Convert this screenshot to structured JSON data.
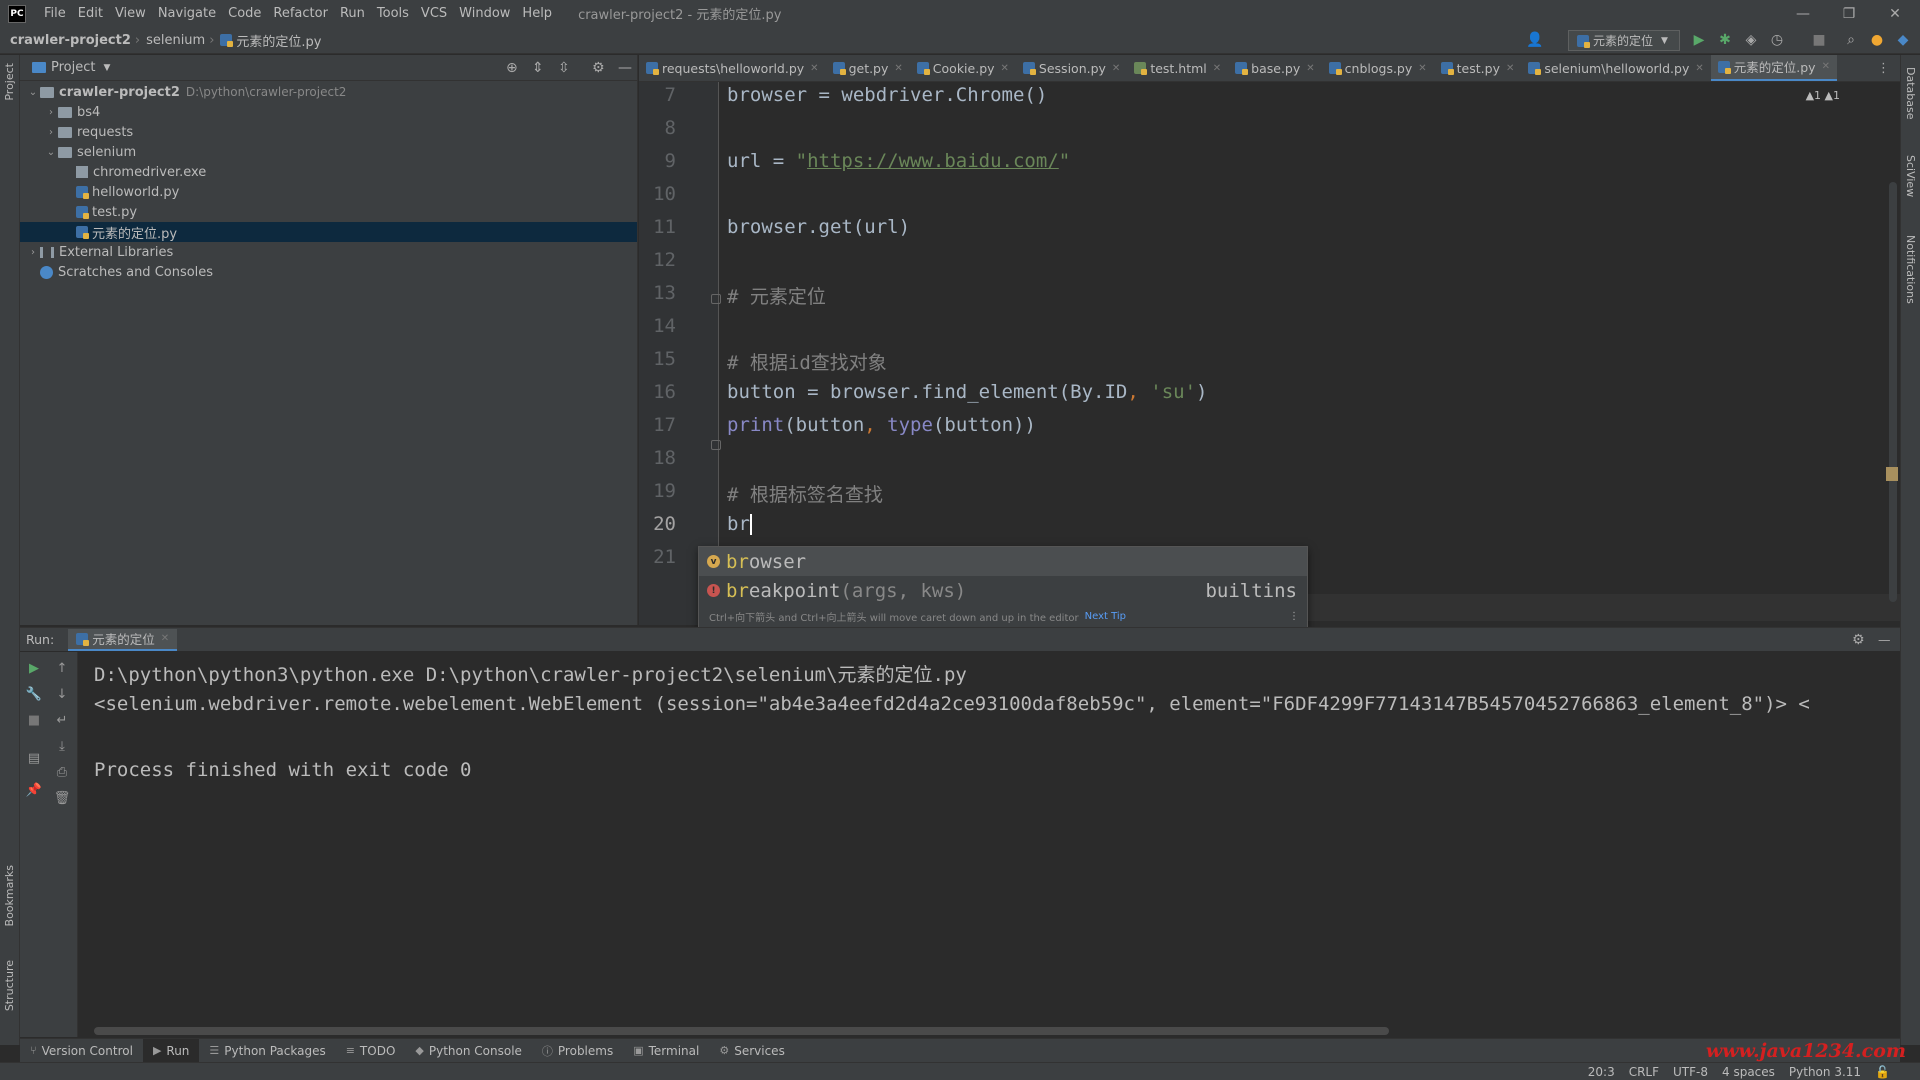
{
  "app": {
    "logo": "PC",
    "window_title": "crawler-project2 - 元素的定位.py"
  },
  "menu": [
    "File",
    "Edit",
    "View",
    "Navigate",
    "Code",
    "Refactor",
    "Run",
    "Tools",
    "VCS",
    "Window",
    "Help"
  ],
  "breadcrumb": {
    "project": "crawler-project2",
    "folder": "selenium",
    "file": "元素的定位.py"
  },
  "run_config": "元素的定位",
  "project_panel": {
    "title": "Project",
    "tree": [
      {
        "label": "crawler-project2",
        "path": "D:\\python\\crawler-project2",
        "depth": 0,
        "type": "folder",
        "expanded": true,
        "bold": true
      },
      {
        "label": "bs4",
        "depth": 1,
        "type": "folder",
        "expanded": false
      },
      {
        "label": "requests",
        "depth": 1,
        "type": "folder",
        "expanded": false
      },
      {
        "label": "selenium",
        "depth": 1,
        "type": "folder",
        "expanded": true
      },
      {
        "label": "chromedriver.exe",
        "depth": 2,
        "type": "exe"
      },
      {
        "label": "helloworld.py",
        "depth": 2,
        "type": "py"
      },
      {
        "label": "test.py",
        "depth": 2,
        "type": "py"
      },
      {
        "label": "元素的定位.py",
        "depth": 2,
        "type": "py",
        "selected": true
      },
      {
        "label": "External Libraries",
        "depth": 0,
        "type": "lib",
        "expanded": false
      },
      {
        "label": "Scratches and Consoles",
        "depth": 0,
        "type": "scratch"
      }
    ]
  },
  "tabs": [
    {
      "label": "requests\\helloworld.py",
      "type": "py"
    },
    {
      "label": "get.py",
      "type": "py"
    },
    {
      "label": "Cookie.py",
      "type": "py"
    },
    {
      "label": "Session.py",
      "type": "py"
    },
    {
      "label": "test.html",
      "type": "html"
    },
    {
      "label": "base.py",
      "type": "py"
    },
    {
      "label": "cnblogs.py",
      "type": "py"
    },
    {
      "label": "test.py",
      "type": "py"
    },
    {
      "label": "selenium\\helloworld.py",
      "type": "py"
    },
    {
      "label": "元素的定位.py",
      "type": "py",
      "active": true
    }
  ],
  "editor": {
    "warnings": "▲1 ▲1",
    "lines": [
      {
        "n": "7",
        "code": "browser = webdriver.Chrome()"
      },
      {
        "n": "8",
        "code": ""
      },
      {
        "n": "9",
        "code_parts": [
          {
            "t": "url = "
          },
          {
            "t": "\"",
            "c": "str"
          },
          {
            "t": "https://www.baidu.com/",
            "c": "url"
          },
          {
            "t": "\"",
            "c": "str"
          }
        ]
      },
      {
        "n": "10",
        "code": ""
      },
      {
        "n": "11",
        "code": "browser.get(url)"
      },
      {
        "n": "12",
        "code": ""
      },
      {
        "n": "13",
        "code": "# 元素定位",
        "c": "cm"
      },
      {
        "n": "14",
        "code": ""
      },
      {
        "n": "15",
        "code": "# 根据id查找对象",
        "c": "cm"
      },
      {
        "n": "16",
        "code_parts": [
          {
            "t": "button = browser.find_element(By.ID"
          },
          {
            "t": ", ",
            "c": "op"
          },
          {
            "t": "'su'",
            "c": "str"
          },
          {
            "t": ")"
          }
        ]
      },
      {
        "n": "17",
        "code_parts": [
          {
            "t": "print",
            "c": "kw"
          },
          {
            "t": "(button"
          },
          {
            "t": ", ",
            "c": "op"
          },
          {
            "t": "type",
            "c": "kw"
          },
          {
            "t": "(button))"
          }
        ]
      },
      {
        "n": "18",
        "code": ""
      },
      {
        "n": "19",
        "code": "# 根据标签名查找",
        "c": "cm"
      },
      {
        "n": "20",
        "code": "br",
        "current": true
      },
      {
        "n": "21",
        "code": ""
      }
    ]
  },
  "autocomplete": {
    "items": [
      {
        "match": "br",
        "rest": "owser",
        "args": "",
        "type": "",
        "badge": "v"
      },
      {
        "match": "br",
        "rest": "eakpoint",
        "args": "(args, kws)",
        "type": "builtins",
        "badge": "f"
      }
    ],
    "tip": "Ctrl+向下箭头 and Ctrl+向上箭头 will move caret down and up in the editor",
    "tip_link": "Next Tip"
  },
  "run": {
    "label": "Run:",
    "tab": "元素的定位",
    "output": [
      "D:\\python\\python3\\python.exe D:\\python\\crawler-project2\\selenium\\元素的定位.py",
      "<selenium.webdriver.remote.webelement.WebElement (session=\"ab4e3a4eefd2d4a2ce93100daf8eb59c\", element=\"F6DF4299F77143147B54570452766863_element_8\")> <",
      "",
      "Process finished with exit code 0"
    ]
  },
  "bottom_tools": [
    {
      "label": "Version Control",
      "icon": "branch-icon"
    },
    {
      "label": "Run",
      "icon": "play-icon",
      "active": true
    },
    {
      "label": "Python Packages",
      "icon": "layers-icon"
    },
    {
      "label": "TODO",
      "icon": "list-icon"
    },
    {
      "label": "Python Console",
      "icon": "python-icon"
    },
    {
      "label": "Problems",
      "icon": "info-icon"
    },
    {
      "label": "Terminal",
      "icon": "terminal-icon"
    },
    {
      "label": "Services",
      "icon": "services-icon"
    }
  ],
  "status": {
    "position": "20:3",
    "line_sep": "CRLF",
    "encoding": "UTF-8",
    "indent": "4 spaces",
    "interpreter": "Python 3.11"
  },
  "side_labels": {
    "left_top": "Project",
    "left_bookmarks": "Bookmarks",
    "left_structure": "Structure",
    "right_db": "Database",
    "right_sci": "SciView",
    "right_notif": "Notifications"
  },
  "watermark": "www.java1234.com"
}
